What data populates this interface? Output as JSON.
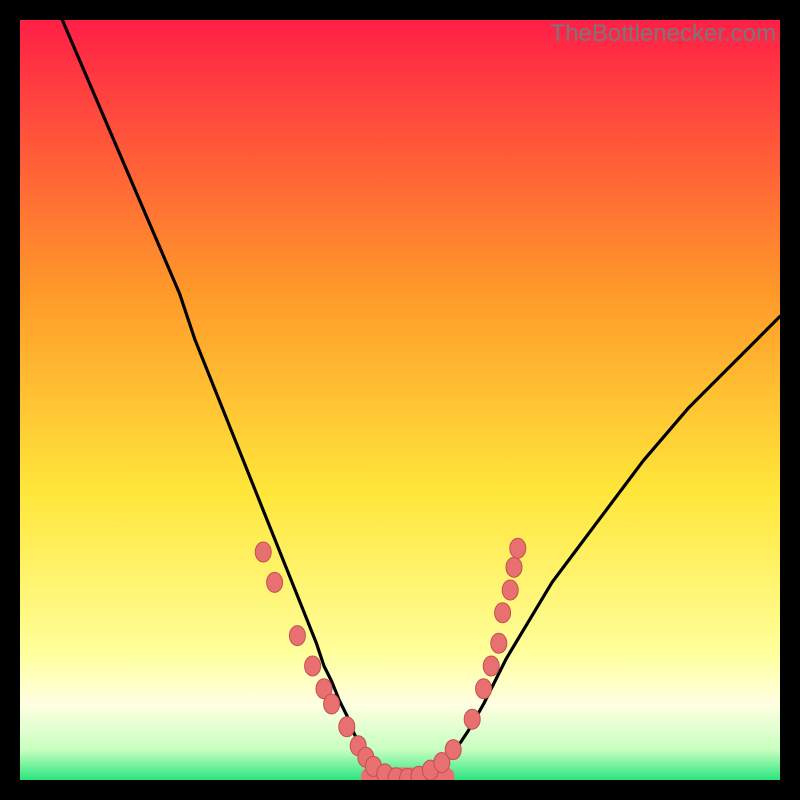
{
  "source_watermark": "TheBottlenecker.com",
  "colors": {
    "background": "#000000",
    "gradient_top": "#ff1f47",
    "gradient_mid1": "#ff9a2a",
    "gradient_mid2": "#ffe63a",
    "gradient_low": "#ffff9a",
    "gradient_band": "#ffffe2",
    "gradient_bottom": "#2be57d",
    "curve": "#000000",
    "markers_fill": "#e87070",
    "markers_stroke": "#c24f4f"
  },
  "chart_data": {
    "type": "line",
    "title": "",
    "xlabel": "",
    "ylabel": "",
    "xlim": [
      0,
      100
    ],
    "ylim": [
      0,
      100
    ],
    "grid": false,
    "legend": false,
    "series": [
      {
        "name": "bottleneck-curve",
        "x": [
          0,
          3,
          6,
          9,
          12,
          15,
          18,
          21,
          23,
          25,
          27,
          29,
          31,
          33,
          35,
          37,
          39,
          40,
          41,
          42,
          43,
          44,
          45,
          46,
          47,
          48,
          49,
          50,
          51,
          52,
          53,
          55,
          56,
          58,
          59,
          61,
          62,
          64,
          67,
          70,
          73,
          76,
          79,
          82,
          85,
          88,
          91,
          94,
          97,
          100
        ],
        "y": [
          113,
          106,
          99,
          92,
          85,
          78,
          71,
          64,
          58,
          53,
          48,
          43,
          38,
          33,
          28,
          23,
          18,
          15,
          13,
          10.5,
          8.5,
          6,
          4.5,
          3,
          2,
          1.2,
          0.6,
          0.2,
          0.1,
          0.2,
          0.5,
          1.2,
          2.2,
          5,
          6.5,
          10,
          12,
          16,
          21,
          26,
          30,
          34,
          38,
          42,
          45.5,
          49,
          52,
          55,
          58,
          61
        ]
      }
    ],
    "markers": [
      {
        "x": 32.0,
        "y": 30.0
      },
      {
        "x": 33.5,
        "y": 26.0
      },
      {
        "x": 36.5,
        "y": 19.0
      },
      {
        "x": 38.5,
        "y": 15.0
      },
      {
        "x": 40.0,
        "y": 12.0
      },
      {
        "x": 41.0,
        "y": 10.0
      },
      {
        "x": 43.0,
        "y": 7.0
      },
      {
        "x": 44.5,
        "y": 4.5
      },
      {
        "x": 45.5,
        "y": 3.0
      },
      {
        "x": 46.5,
        "y": 1.8
      },
      {
        "x": 48.0,
        "y": 0.8
      },
      {
        "x": 49.5,
        "y": 0.3
      },
      {
        "x": 51.0,
        "y": 0.2
      },
      {
        "x": 52.5,
        "y": 0.5
      },
      {
        "x": 54.0,
        "y": 1.3
      },
      {
        "x": 55.5,
        "y": 2.3
      },
      {
        "x": 57.0,
        "y": 4.0
      },
      {
        "x": 59.5,
        "y": 8.0
      },
      {
        "x": 61.0,
        "y": 12.0
      },
      {
        "x": 62.0,
        "y": 15.0
      },
      {
        "x": 63.0,
        "y": 18.0
      },
      {
        "x": 63.5,
        "y": 22.0
      },
      {
        "x": 64.5,
        "y": 25.0
      },
      {
        "x": 65.0,
        "y": 28.0
      },
      {
        "x": 65.5,
        "y": 30.5
      }
    ],
    "bottom_band": {
      "x_start": 46,
      "x_end": 56,
      "y": 0.5,
      "thickness": 2.3
    }
  }
}
